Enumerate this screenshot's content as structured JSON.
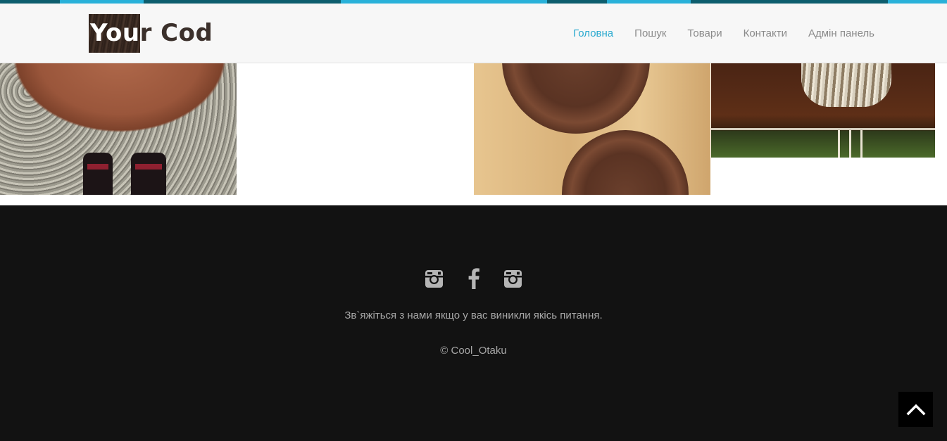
{
  "logo": {
    "text_on_box": "You",
    "text_off_box": "r Cod"
  },
  "nav": {
    "items": [
      {
        "label": "Головна",
        "active": true
      },
      {
        "label": "Пошук",
        "active": false
      },
      {
        "label": "Товари",
        "active": false
      },
      {
        "label": "Контакти",
        "active": false
      },
      {
        "label": "Адмін панель",
        "active": false
      }
    ]
  },
  "colors": {
    "accent": "#29a9cf",
    "strip_dark": "#0d5e6e",
    "footer_bg": "#121212",
    "footer_text": "#a7a7a7",
    "nav_text": "#8a8a8a"
  },
  "footer": {
    "social_icons": [
      "instagram-icon",
      "facebook-icon",
      "instagram-icon"
    ],
    "contact_text": "Зв`яжіться з нами якщо у вас виникли якісь питання.",
    "copyright": "© Cool_Otaku"
  },
  "back_to_top": {
    "icon": "chevron-up-icon"
  }
}
